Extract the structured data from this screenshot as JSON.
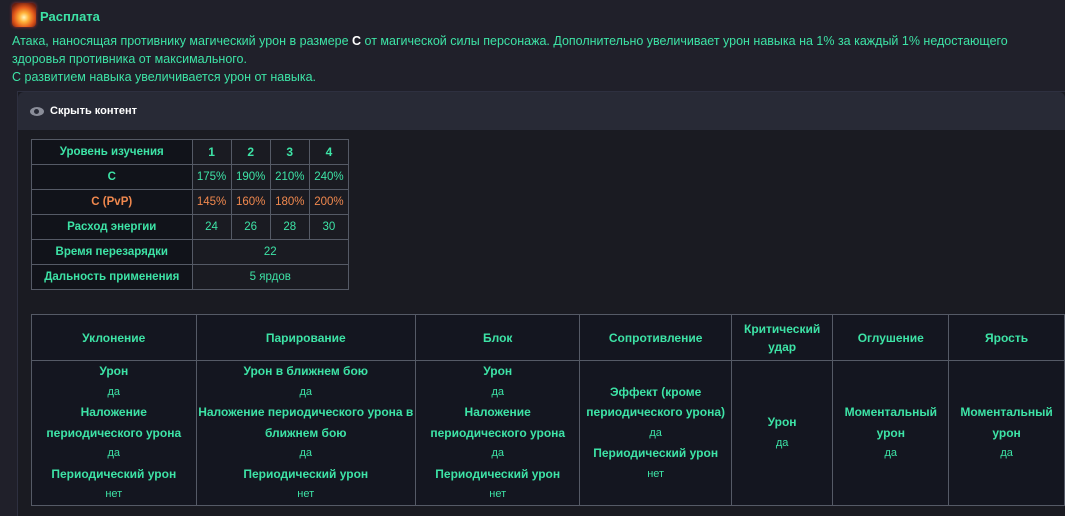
{
  "skill": {
    "title": "Расплата",
    "desc_part1": "Атака, наносящая противнику магический урон в размере ",
    "desc_bold": "С",
    "desc_part2": " от магической силы персонажа. Дополнительно увеличивает урон навыка на 1% за каждый 1% недостающего здоровья противника от максимального.",
    "desc_line2": "С развитием навыка увеличивается урон от навыка."
  },
  "spoiler": {
    "label": "Скрыть контент",
    "icon": "eye-icon"
  },
  "levels_table": {
    "header_label": "Уровень изучения",
    "levels": [
      "1",
      "2",
      "3",
      "4"
    ],
    "c_label": "С",
    "c_values": [
      "175%",
      "190%",
      "210%",
      "240%"
    ],
    "pvp_label": "С (PvP)",
    "pvp_values": [
      "145%",
      "160%",
      "180%",
      "200%"
    ],
    "energy_label": "Расход энергии",
    "energy_values": [
      "24",
      "26",
      "28",
      "30"
    ],
    "cooldown_label": "Время перезарядки",
    "cooldown_value": "22",
    "range_label": "Дальность применения",
    "range_value": "5 ярдов"
  },
  "effects_table": {
    "headers": [
      "Уклонение",
      "Парирование",
      "Блок",
      "Сопротивление",
      "Критический удар",
      "Оглушение",
      "Ярость"
    ],
    "columns": [
      [
        {
          "label": "Урон",
          "value": "да"
        },
        {
          "label": "Наложение периодического урона",
          "value": "да"
        },
        {
          "label": "Периодический урон",
          "value": "нет"
        }
      ],
      [
        {
          "label": "Урон в ближнем бою",
          "value": "да"
        },
        {
          "label": "Наложение периодического урона в ближнем бою",
          "value": "да"
        },
        {
          "label": "Периодический урон",
          "value": "нет"
        }
      ],
      [
        {
          "label": "Урон",
          "value": "да"
        },
        {
          "label": "Наложение периодического урона",
          "value": "да"
        },
        {
          "label": "Периодический урон",
          "value": "нет"
        }
      ],
      [
        {
          "label": "Эффект (кроме периодического урона)",
          "value": "да"
        },
        {
          "label": "Периодический урон",
          "value": "нет"
        }
      ],
      [
        {
          "label": "Урон",
          "value": "да"
        }
      ],
      [
        {
          "label": "Моментальный урон",
          "value": "да"
        }
      ],
      [
        {
          "label": "Моментальный урон",
          "value": "да"
        }
      ]
    ]
  }
}
